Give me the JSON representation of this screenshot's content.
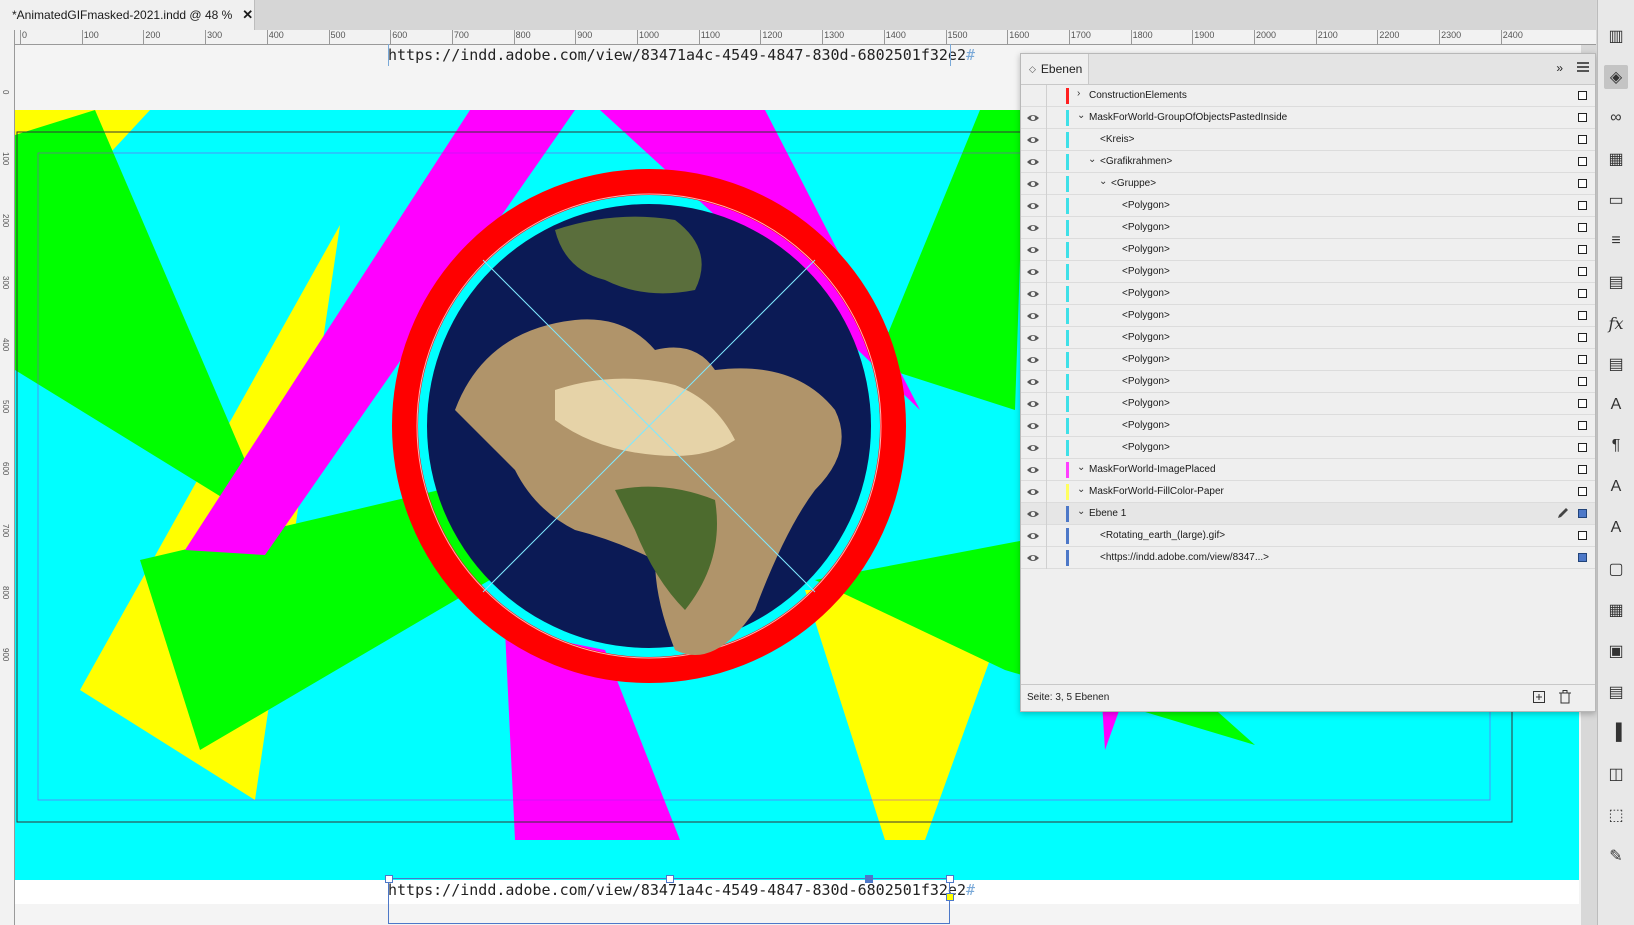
{
  "document_tab": {
    "title": "*AnimatedGIFmasked-2021.indd @ 48 %",
    "close_symbol": "✕"
  },
  "ruler": {
    "top_ticks": [
      "0",
      "100",
      "200",
      "300",
      "400",
      "500",
      "600",
      "700",
      "800",
      "900",
      "1000",
      "1100",
      "1200",
      "1300",
      "1400",
      "1500",
      "1600",
      "1700",
      "1800",
      "1900",
      "2000",
      "2100",
      "2200",
      "2300",
      "2400"
    ],
    "left_ticks": [
      "0",
      "100",
      "200",
      "300",
      "400",
      "500",
      "600",
      "700",
      "800",
      "900"
    ]
  },
  "canvas": {
    "url_text_top": "https://indd.adobe.com/view/83471a4c-4549-4847-830d-6802501f32e2",
    "url_text_bottom": "https://indd.adobe.com/view/83471a4c-4549-4847-830d-6802501f32e2",
    "hash_mark": "#",
    "colors": {
      "cyan": "#00ffff",
      "magenta": "#ff00ff",
      "green": "#00ff00",
      "yellow": "#ffff00",
      "red": "#ff0000"
    }
  },
  "layers_panel": {
    "tab_label": "Ebenen",
    "collapse_symbol": "»",
    "footer_text": "Seite: 3, 5 Ebenen",
    "rows": [
      {
        "label": "ConstructionElements",
        "color": "#ff2020",
        "expander": "›",
        "visible": false
      },
      {
        "label": "MaskForWorld-GroupOfObjectsPastedInside",
        "color": "#3ee0e8",
        "expander": "⌄",
        "visible": true
      },
      {
        "label": "<Kreis>",
        "color": "#3ee0e8",
        "expander": "",
        "visible": true
      },
      {
        "label": "<Grafikrahmen>",
        "color": "#3ee0e8",
        "expander": "⌄",
        "visible": true
      },
      {
        "label": "<Gruppe>",
        "color": "#3ee0e8",
        "expander": "⌄",
        "visible": true
      },
      {
        "label": "<Polygon>",
        "color": "#3ee0e8",
        "expander": "",
        "visible": true
      },
      {
        "label": "<Polygon>",
        "color": "#3ee0e8",
        "expander": "",
        "visible": true
      },
      {
        "label": "<Polygon>",
        "color": "#3ee0e8",
        "expander": "",
        "visible": true
      },
      {
        "label": "<Polygon>",
        "color": "#3ee0e8",
        "expander": "",
        "visible": true
      },
      {
        "label": "<Polygon>",
        "color": "#3ee0e8",
        "expander": "",
        "visible": true
      },
      {
        "label": "<Polygon>",
        "color": "#3ee0e8",
        "expander": "",
        "visible": true
      },
      {
        "label": "<Polygon>",
        "color": "#3ee0e8",
        "expander": "",
        "visible": true
      },
      {
        "label": "<Polygon>",
        "color": "#3ee0e8",
        "expander": "",
        "visible": true
      },
      {
        "label": "<Polygon>",
        "color": "#3ee0e8",
        "expander": "",
        "visible": true
      },
      {
        "label": "<Polygon>",
        "color": "#3ee0e8",
        "expander": "",
        "visible": true
      },
      {
        "label": "<Polygon>",
        "color": "#3ee0e8",
        "expander": "",
        "visible": true
      },
      {
        "label": "<Polygon>",
        "color": "#3ee0e8",
        "expander": "",
        "visible": true
      },
      {
        "label": "MaskForWorld-ImagePlaced",
        "color": "#ff40ff",
        "expander": "⌄",
        "visible": true
      },
      {
        "label": "MaskForWorld-FillColor-Paper",
        "color": "#ffff60",
        "expander": "⌄",
        "visible": true
      },
      {
        "label": "Ebene 1",
        "color": "#4d78c8",
        "expander": "⌄",
        "visible": true
      },
      {
        "label": "<Rotating_earth_(large).gif>",
        "color": "#4d78c8",
        "expander": "",
        "visible": true
      },
      {
        "label": "<https://indd.adobe.com/view/8347...>",
        "color": "#4d78c8",
        "expander": "",
        "visible": true
      }
    ]
  },
  "right_toolbar": {
    "tools": [
      "pages-icon",
      "layers-icon",
      "links-icon",
      "swatches-icon",
      "gradient-icon",
      "stroke-icon",
      "text-wrap-icon",
      "effects-icon",
      "align-text-icon",
      "character-styles-icon",
      "paragraph-icon",
      "character-icon",
      "glyphs-icon",
      "object-styles-icon",
      "table-icon",
      "cell-styles-icon",
      "table-styles-icon",
      "align-icon",
      "pathfinder-icon",
      "transform-icon",
      "scripts-icon"
    ],
    "effects_glyph": "fx",
    "paragraph_glyph": "¶",
    "character_glyph": "A"
  }
}
